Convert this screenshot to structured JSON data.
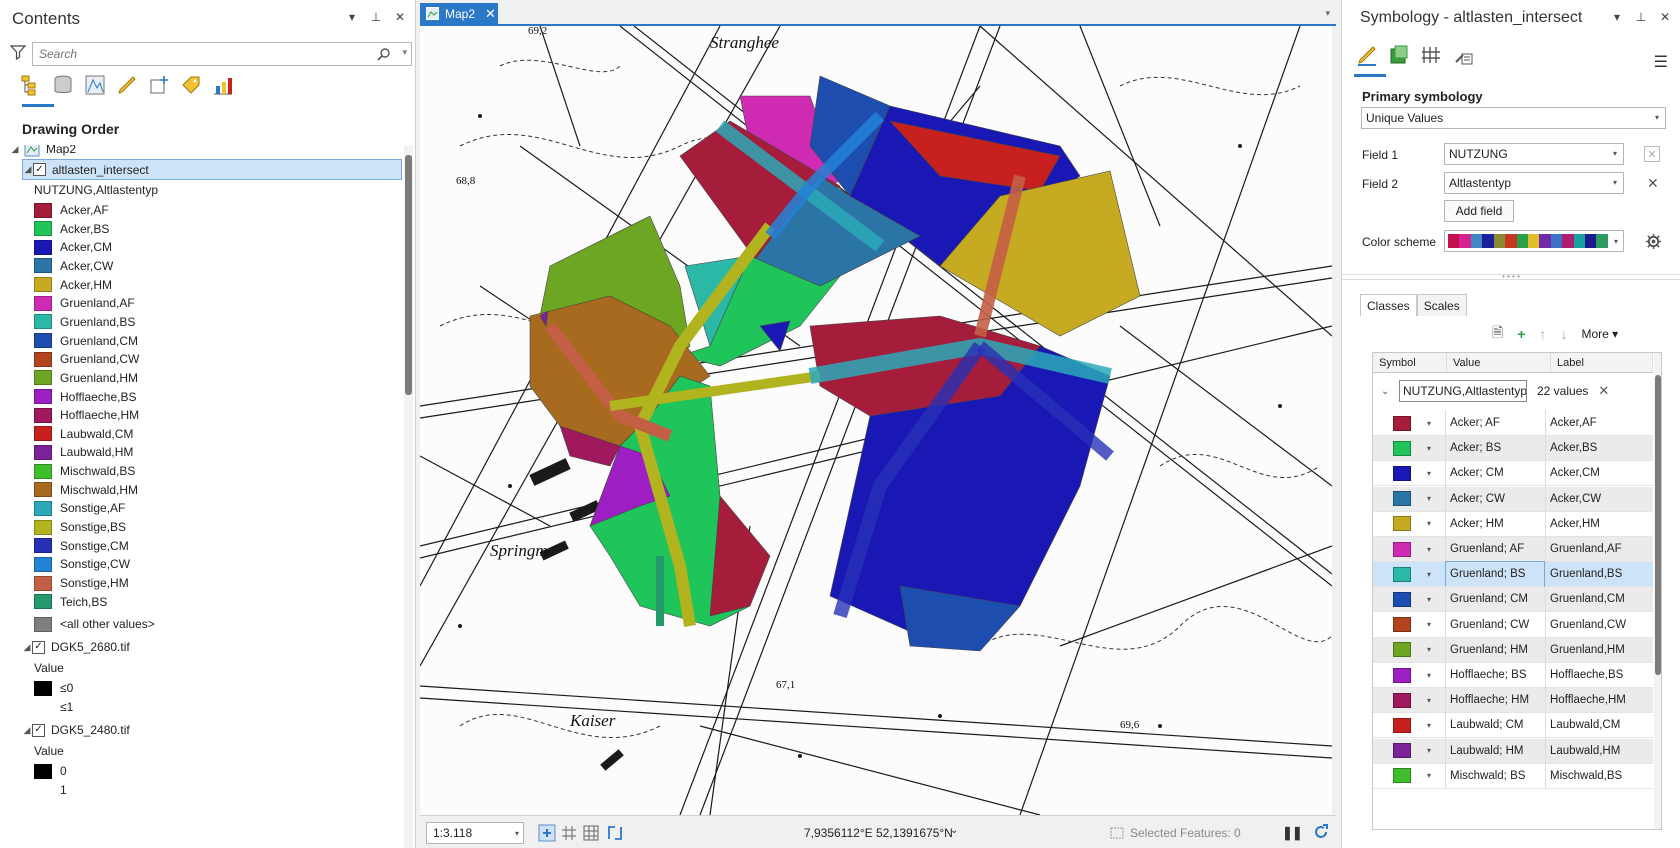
{
  "contents": {
    "title": "Contents",
    "search_placeholder": "Search",
    "drawing_order": "Drawing Order",
    "map_name": "Map2",
    "layer_name": "altlasten_intersect",
    "field_label": "NUTZUNG,Altlastentyp",
    "legend_items": [
      {
        "label": "Acker,AF",
        "color": "#a51d3b"
      },
      {
        "label": "Acker,BS",
        "color": "#1fc45b"
      },
      {
        "label": "Acker,CM",
        "color": "#1a18b5"
      },
      {
        "label": "Acker,CW",
        "color": "#2a75a6"
      },
      {
        "label": "Acker,HM",
        "color": "#c6ab22"
      },
      {
        "label": "Gruenland,AF",
        "color": "#cf2bb2"
      },
      {
        "label": "Gruenland,BS",
        "color": "#2bb8a6"
      },
      {
        "label": "Gruenland,CM",
        "color": "#1e4db0"
      },
      {
        "label": "Gruenland,CW",
        "color": "#b3431c"
      },
      {
        "label": "Gruenland,HM",
        "color": "#6ca623"
      },
      {
        "label": "Hofflaeche,BS",
        "color": "#9d1fc4"
      },
      {
        "label": "Hofflaeche,HM",
        "color": "#a0185e"
      },
      {
        "label": "Laubwald,CM",
        "color": "#c8201f"
      },
      {
        "label": "Laubwald,HM",
        "color": "#7b2299"
      },
      {
        "label": "Mischwald,BS",
        "color": "#3fbe2c"
      },
      {
        "label": "Mischwald,HM",
        "color": "#a76a1f"
      },
      {
        "label": "Sonstige,AF",
        "color": "#2ba9b8"
      },
      {
        "label": "Sonstige,BS",
        "color": "#b2b41f"
      },
      {
        "label": "Sonstige,CM",
        "color": "#2731b6"
      },
      {
        "label": "Sonstige,CW",
        "color": "#2383d6"
      },
      {
        "label": "Sonstige,HM",
        "color": "#c35f45"
      },
      {
        "label": "Teich,BS",
        "color": "#23996c"
      },
      {
        "label": "<all other values>",
        "color": "#7f7f7f"
      }
    ],
    "raster1": {
      "name": "DGK5_2680.tif",
      "value_label": "Value",
      "items": [
        "≤0",
        "≤1"
      ]
    },
    "raster2": {
      "name": "DGK5_2480.tif",
      "value_label": "Value",
      "items": [
        "0",
        "1"
      ]
    }
  },
  "map": {
    "tab_label": "Map2",
    "scale": "1:3.118",
    "coordinates": "7,9356112°E 52,1391675°N",
    "selected_features": "Selected Features: 0",
    "labels": {
      "street_top": "Stranghee",
      "street_left": "Springm",
      "street_bottom": "Kaiser",
      "elev1": "69,2",
      "elev2": "68,8",
      "elev3": "67,1",
      "elev4": "69,6"
    }
  },
  "symbology": {
    "title": "Symbology - altlasten_intersect",
    "primary_label": "Primary symbology",
    "renderer": "Unique Values",
    "field1_label": "Field 1",
    "field1_value": "NUTZUNG",
    "field2_label": "Field 2",
    "field2_value": "Altlastentyp",
    "add_field": "Add field",
    "color_scheme_label": "Color scheme",
    "color_scheme": [
      "#c5114a",
      "#d6248f",
      "#3f88c5",
      "#1c1f9a",
      "#8a8a32",
      "#c43a21",
      "#2ba04b",
      "#e0bd2b",
      "#6f2aa9",
      "#3c71c6",
      "#ad1f6d",
      "#17a2a1",
      "#1d1a8f",
      "#2b9b62"
    ],
    "tabs": {
      "classes": "Classes",
      "scales": "Scales"
    },
    "more": "More",
    "columns": {
      "symbol": "Symbol",
      "value": "Value",
      "label": "Label"
    },
    "group_field": "NUTZUNG,Altlastentyp",
    "group_count": "22 values",
    "classes": [
      {
        "value": "Acker; AF",
        "label": "Acker,AF",
        "color": "#a51d3b"
      },
      {
        "value": "Acker; BS",
        "label": "Acker,BS",
        "color": "#1fc45b"
      },
      {
        "value": "Acker; CM",
        "label": "Acker,CM",
        "color": "#1a18b5"
      },
      {
        "value": "Acker; CW",
        "label": "Acker,CW",
        "color": "#2a75a6"
      },
      {
        "value": "Acker; HM",
        "label": "Acker,HM",
        "color": "#c6ab22"
      },
      {
        "value": "Gruenland; AF",
        "label": "Gruenland,AF",
        "color": "#cf2bb2"
      },
      {
        "value": "Gruenland; BS",
        "label": "Gruenland,BS",
        "color": "#2bb8a6"
      },
      {
        "value": "Gruenland; CM",
        "label": "Gruenland,CM",
        "color": "#1e4db0"
      },
      {
        "value": "Gruenland; CW",
        "label": "Gruenland,CW",
        "color": "#b3431c"
      },
      {
        "value": "Gruenland; HM",
        "label": "Gruenland,HM",
        "color": "#6ca623"
      },
      {
        "value": "Hofflaeche; BS",
        "label": "Hofflaeche,BS",
        "color": "#9d1fc4"
      },
      {
        "value": "Hofflaeche; HM",
        "label": "Hofflaeche,HM",
        "color": "#a0185e"
      },
      {
        "value": "Laubwald; CM",
        "label": "Laubwald,CM",
        "color": "#c8201f"
      },
      {
        "value": "Laubwald; HM",
        "label": "Laubwald,HM",
        "color": "#7b2299"
      },
      {
        "value": "Mischwald; BS",
        "label": "Mischwald,BS",
        "color": "#3fbe2c"
      }
    ]
  }
}
